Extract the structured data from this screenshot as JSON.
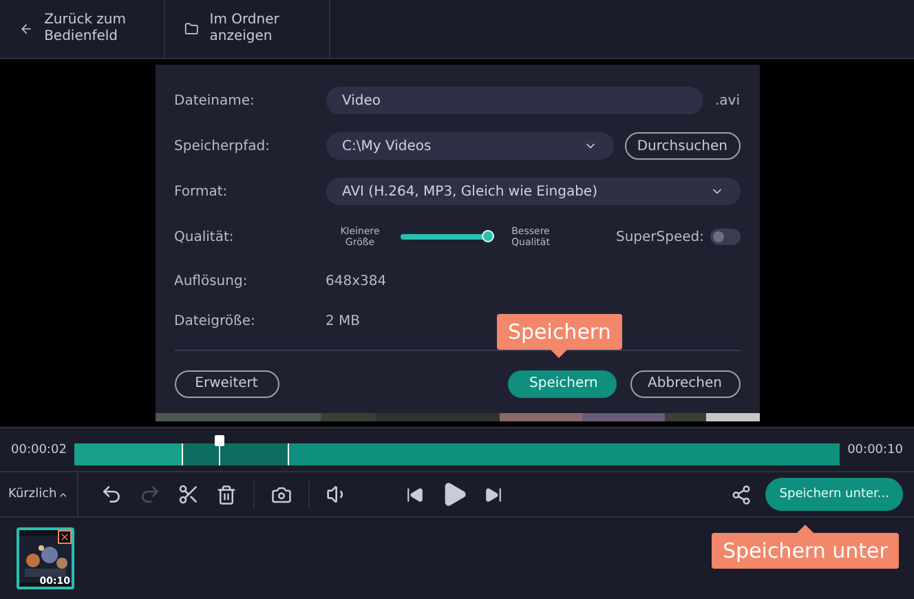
{
  "top_bar": [
    {
      "kind": "back",
      "label": "Zurück zum Bedienfeld"
    },
    {
      "kind": "folder",
      "label": "Im Ordner anzeigen"
    }
  ],
  "dialog": {
    "filename": {
      "label": "Dateiname:",
      "value": "Video",
      "extension": ".avi"
    },
    "path": {
      "label": "Speicherpfad:",
      "value": "C:\\My Videos",
      "browse": "Durchsuchen"
    },
    "format": {
      "label": "Format:",
      "value": "AVI (H.264, MP3, Gleich wie Eingabe)"
    },
    "quality": {
      "label": "Qualität:",
      "min_label": "Kleinere Größe",
      "max_label": "Bessere Qualität",
      "level": 0.97
    },
    "superspeed": {
      "label": "SuperSpeed:",
      "on": false
    },
    "info": [
      {
        "label": "Auflösung:",
        "value": "648x384"
      },
      {
        "label": "Dateigröße:",
        "value": "2 MB"
      }
    ],
    "advanced": "Erweitert",
    "save": "Speichern",
    "cancel": "Abbrechen"
  },
  "timeline": {
    "start": "00:00:02",
    "end": "00:00:10",
    "level": 0.19
  },
  "toolbar": {
    "recent": "Kürzlich",
    "save_as": "Speichern unter..."
  },
  "clip": {
    "duration": "00:10"
  },
  "callouts": [
    {
      "kind": "save",
      "text": "Speichern"
    },
    {
      "kind": "save_as",
      "text": "Speichern unter"
    }
  ]
}
